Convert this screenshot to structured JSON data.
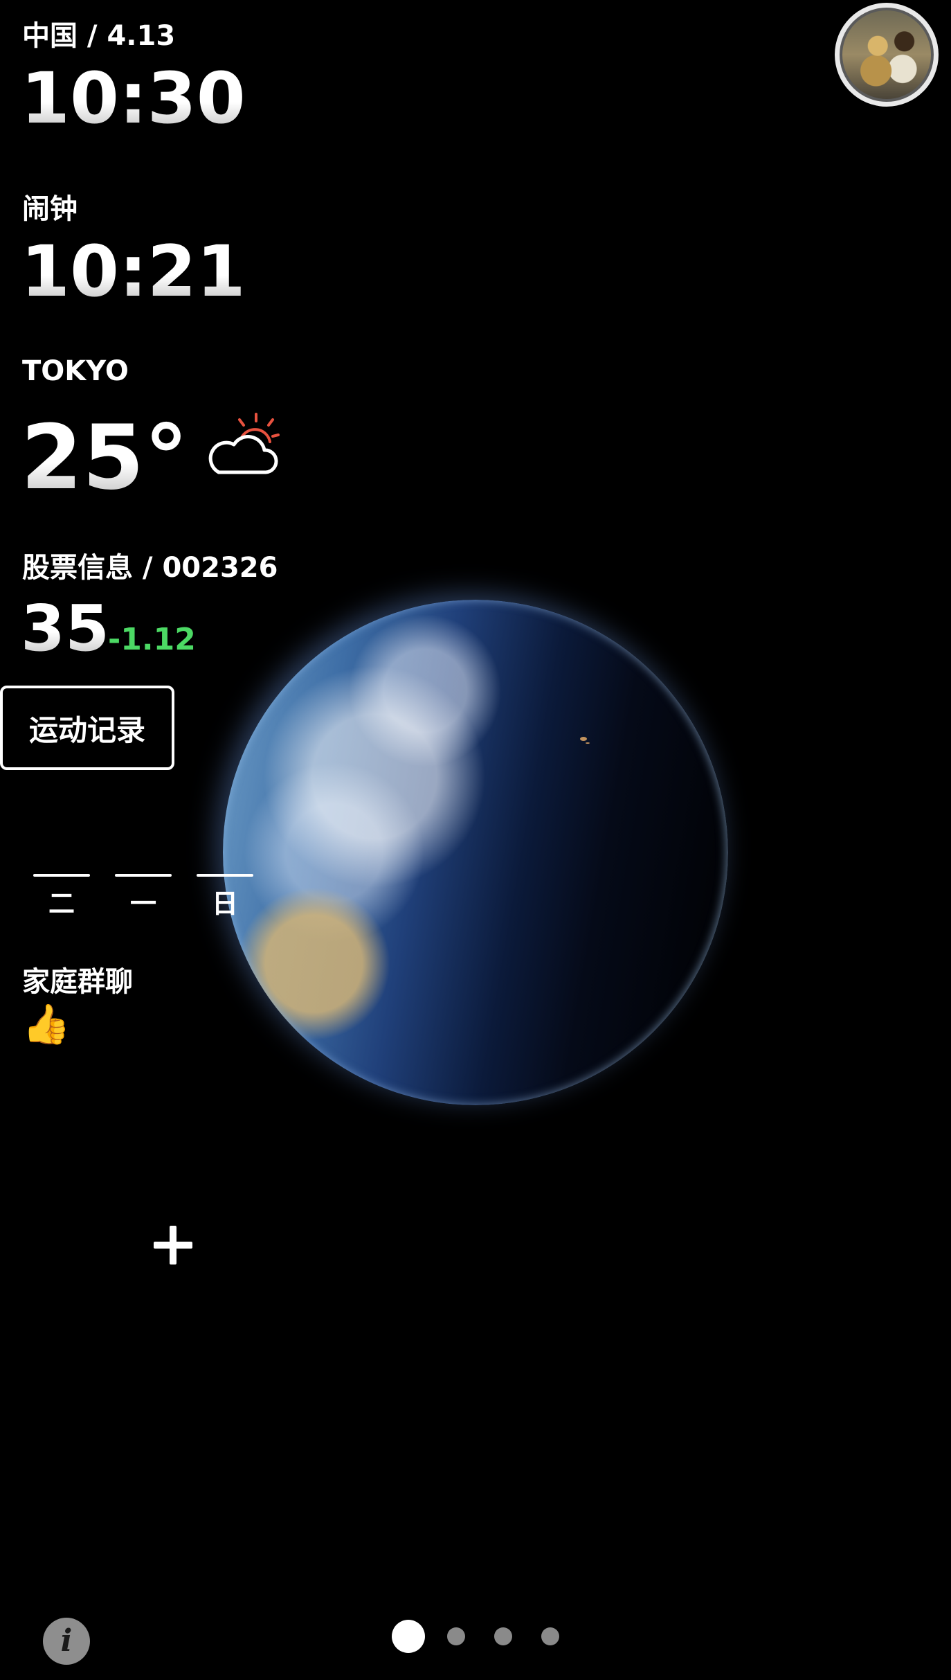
{
  "clock": {
    "region_date": "中国 / 4.13",
    "time": "10:30"
  },
  "alarm": {
    "label": "闹钟",
    "time": "10:21"
  },
  "weather": {
    "city": "TOKYO",
    "temperature": "25°",
    "icon": "partly-cloudy-sun-icon",
    "sun_color": "#e8523f"
  },
  "stock": {
    "label": "股票信息 / 002326",
    "price": "35",
    "change": "-1.12",
    "change_color": "#4cd964"
  },
  "sport": {
    "button_label": "运动记录"
  },
  "days": [
    {
      "label": "二"
    },
    {
      "label": "一"
    },
    {
      "label": "日"
    }
  ],
  "family_chat": {
    "label": "家庭群聊",
    "last_message": "👍"
  },
  "add_button": {
    "icon": "plus-icon"
  },
  "info_button": {
    "label": "i"
  },
  "pager": {
    "page_count": 4,
    "current_page": 1
  }
}
